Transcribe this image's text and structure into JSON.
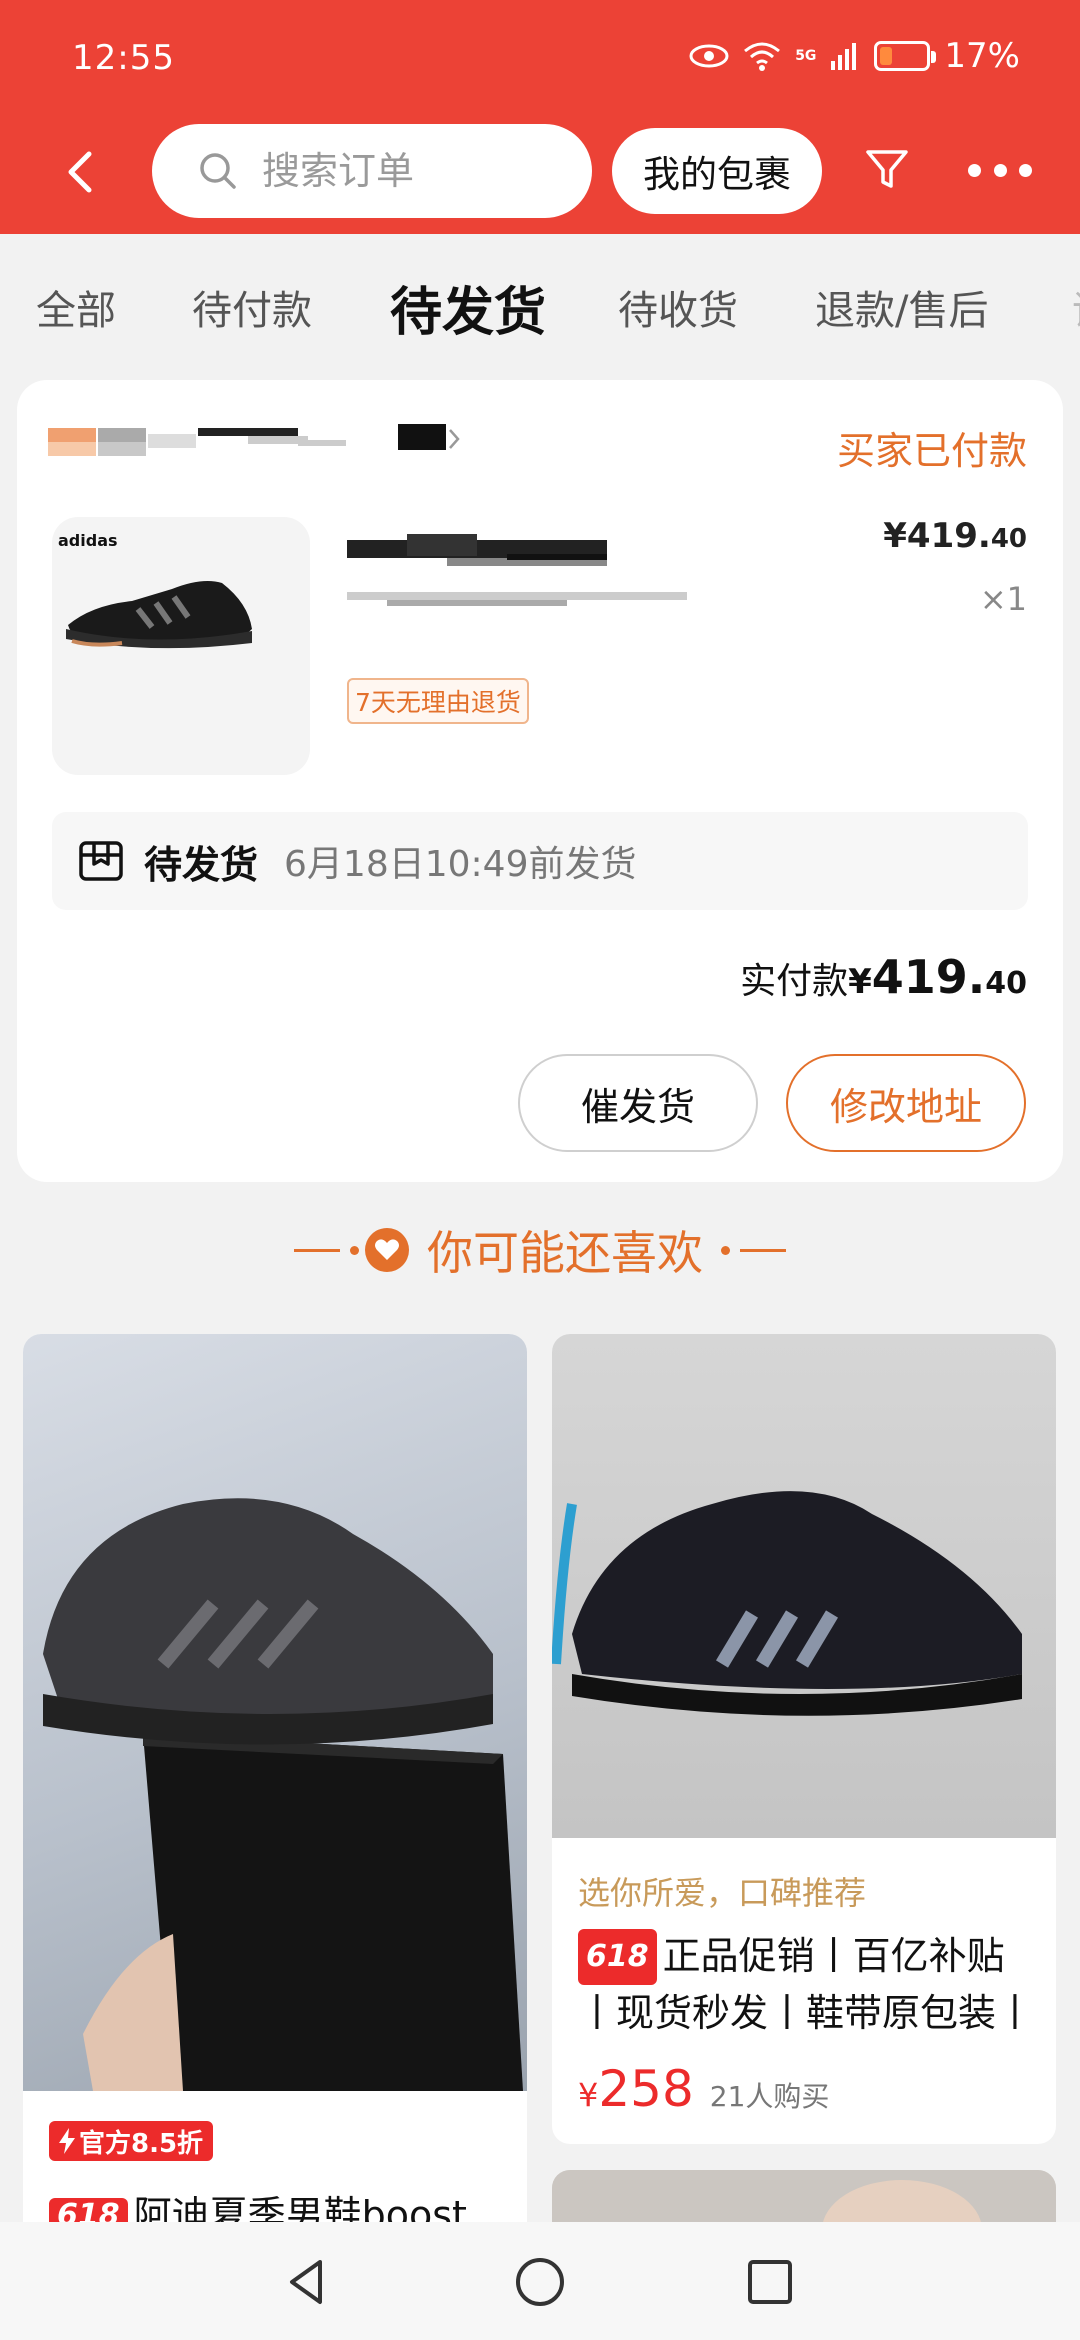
{
  "status_bar": {
    "time": "12:55",
    "network": "5G",
    "battery": "17%",
    "battery_level": 0.17
  },
  "header": {
    "search_placeholder": "搜索订单",
    "my_parcels": "我的包裹"
  },
  "tabs": [
    {
      "label": "全部"
    },
    {
      "label": "待付款"
    },
    {
      "label": "待发货",
      "active": true
    },
    {
      "label": "待收货"
    },
    {
      "label": "退款/售后"
    }
  ],
  "order": {
    "status": "买家已付款",
    "brand": "adidas",
    "price_main": "¥419.",
    "price_decimal": "40",
    "quantity": "×1",
    "return_tag": "7天无理由退货",
    "ship_status": "待发货",
    "ship_deadline": "6月18日10:49前发货",
    "paid_label": "实付款",
    "paid_yen": "¥",
    "paid_main": "419.",
    "paid_decimal": "40",
    "urge_button": "催发货",
    "address_button": "修改地址"
  },
  "recommend": {
    "heading": "你可能还喜欢",
    "items": [
      {
        "promo": "官方8.5折",
        "tag": "618",
        "title": "阿迪夏季男鞋boost"
      },
      {
        "slogan": "选你所爱，口碑推荐",
        "tag": "618",
        "title_line1": "正品促销丨百亿补贴",
        "title_line2": "丨现货秒发丨鞋带原包装丨",
        "price_yen": "¥",
        "price": "258",
        "sold": "21人购买"
      }
    ]
  },
  "colors": {
    "header": "#ec4236",
    "accent": "#e3702b",
    "promo_red": "#ec2b2b"
  }
}
